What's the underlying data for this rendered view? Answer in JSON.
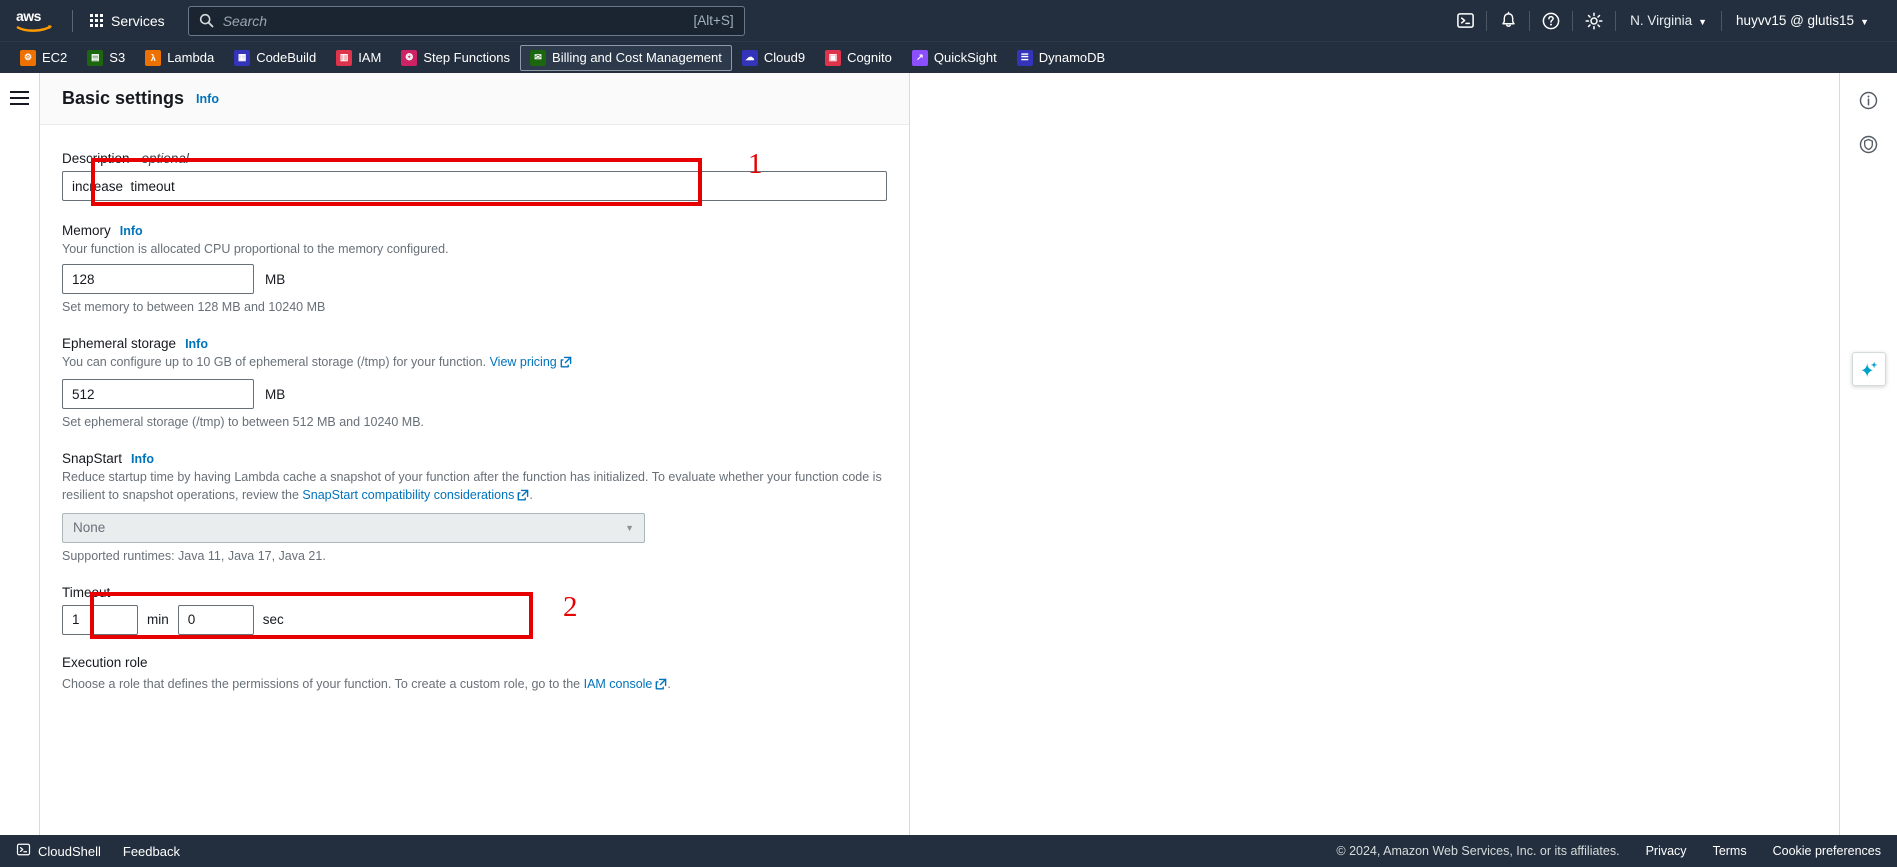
{
  "topnav": {
    "logo_alt": "aws",
    "services_label": "Services",
    "search_placeholder": "Search",
    "search_value": "",
    "search_shortcut": "[Alt+S]",
    "region": "N. Virginia",
    "account": "huyvv15 @ glutis15",
    "icons": [
      "cloudshell-icon",
      "notifications-bell-icon",
      "help-question-icon",
      "settings-gear-icon"
    ]
  },
  "favorites": [
    {
      "label": "EC2",
      "color": "#ed7100",
      "glyph": "⚙",
      "active": false
    },
    {
      "label": "S3",
      "color": "#1b660f",
      "glyph": "▤",
      "active": false
    },
    {
      "label": "Lambda",
      "color": "#ed7100",
      "glyph": "λ",
      "active": false
    },
    {
      "label": "CodeBuild",
      "color": "#3334b9",
      "glyph": "▦",
      "active": false
    },
    {
      "label": "IAM",
      "color": "#dd344c",
      "glyph": "▥",
      "active": false
    },
    {
      "label": "Step Functions",
      "color": "#cd2264",
      "glyph": "⁂",
      "active": false
    },
    {
      "label": "Billing and Cost Management",
      "color": "#1b660f",
      "glyph": "✉",
      "active": true
    },
    {
      "label": "Cloud9",
      "color": "#3334b9",
      "glyph": "☁",
      "active": false
    },
    {
      "label": "Cognito",
      "color": "#dd344c",
      "glyph": "▣",
      "active": false
    },
    {
      "label": "QuickSight",
      "color": "#8c4fff",
      "glyph": "↗",
      "active": false
    },
    {
      "label": "DynamoDB",
      "color": "#3334b9",
      "glyph": "☰",
      "active": false
    }
  ],
  "panel": {
    "title": "Basic settings",
    "info_label": "Info"
  },
  "form": {
    "description": {
      "label": "Description - ",
      "label_optional": "optional",
      "value": "increase  timeout"
    },
    "memory": {
      "label": "Memory",
      "info": "Info",
      "helper": "Your function is allocated CPU proportional to the memory configured.",
      "value": "128",
      "unit": "MB",
      "constraint": "Set memory to between 128 MB and 10240 MB"
    },
    "ephemeral_storage": {
      "label": "Ephemeral storage",
      "info": "Info",
      "helper_pre": "You can configure up to 10 GB of ephemeral storage (/tmp) for your function. ",
      "helper_link": "View pricing",
      "value": "512",
      "unit": "MB",
      "constraint": "Set ephemeral storage (/tmp) to between 512 MB and 10240 MB."
    },
    "snapstart": {
      "label": "SnapStart",
      "info": "Info",
      "helper_pre": "Reduce startup time by having Lambda cache a snapshot of your function after the function has initialized. To evaluate whether your function code is resilient to snapshot operations, review the ",
      "helper_link": "SnapStart compatibility considerations",
      "helper_post": ".",
      "selected": "None",
      "constraint": "Supported runtimes: Java 11, Java 17, Java 21."
    },
    "timeout": {
      "label": "Timeout",
      "min_value": "1",
      "min_unit": "min",
      "sec_value": "0",
      "sec_unit": "sec"
    },
    "execution_role": {
      "label": "Execution role",
      "helper_pre": "Choose a role that defines the permissions of your function. To create a custom role, go to the ",
      "helper_link": "IAM console",
      "helper_post": "."
    }
  },
  "annotations": [
    {
      "number": "1",
      "target": "description-field"
    },
    {
      "number": "2",
      "target": "timeout-field"
    }
  ],
  "right_rail": {
    "icons": [
      "info-circle-icon",
      "shield-circle-icon",
      "assistant-sparkle-icon"
    ]
  },
  "footer": {
    "cloudshell": "CloudShell",
    "feedback": "Feedback",
    "copyright": "© 2024, Amazon Web Services, Inc. or its affiliates.",
    "links": [
      "Privacy",
      "Terms",
      "Cookie preferences"
    ]
  },
  "colors": {
    "nav_bg": "#232f3e",
    "link_blue": "#0073bb",
    "annotation_red": "#e60000",
    "helper_gray": "#687078"
  }
}
